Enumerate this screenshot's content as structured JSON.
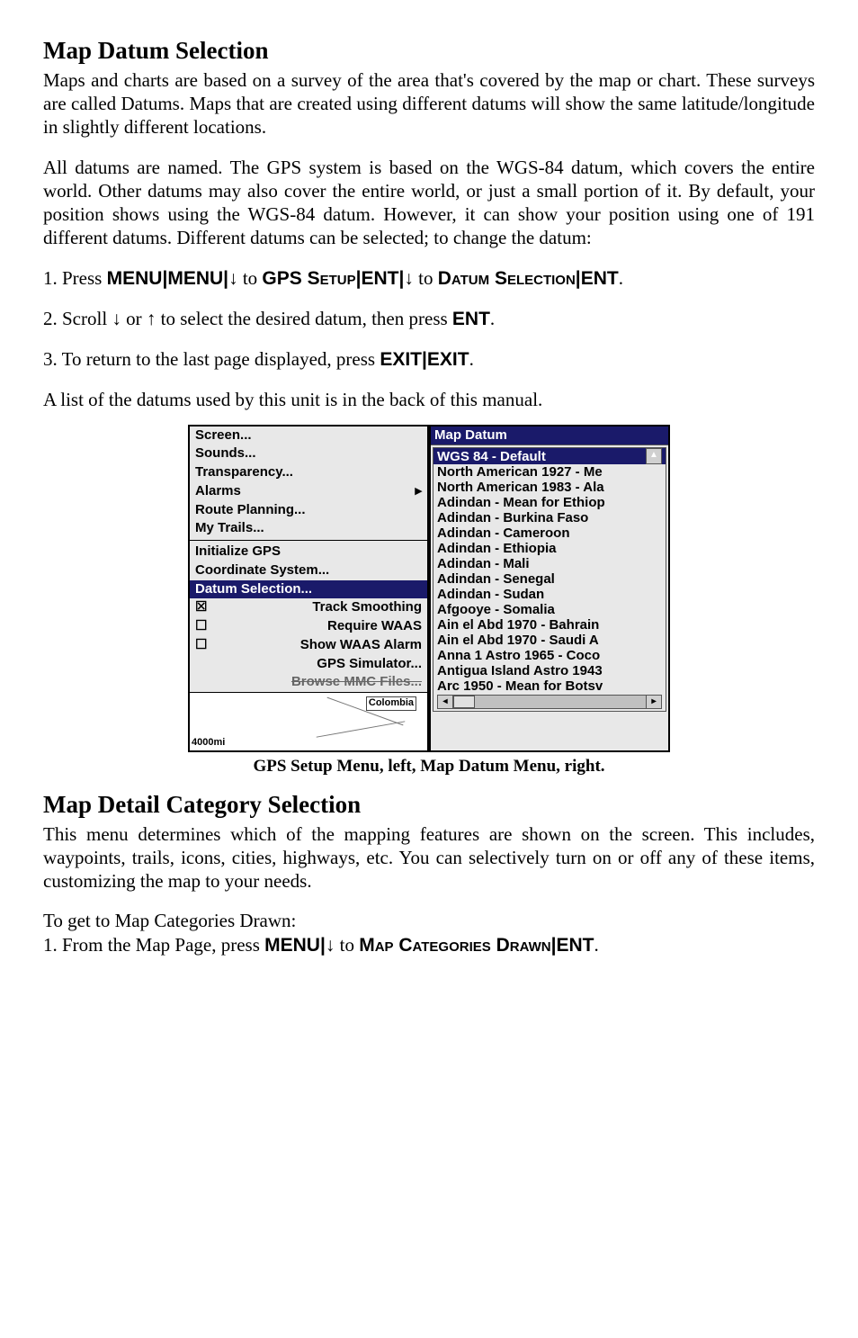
{
  "section1": {
    "heading": "Map Datum Selection",
    "para1": "Maps and charts are based on a survey of the area that's covered by the map or chart. These surveys are called Datums. Maps that are created using different datums will show the same latitude/longitude in slightly different locations.",
    "para2": "All datums are named. The GPS system is based on the WGS-84 datum, which covers the entire world. Other datums may also cover the entire world, or just a small portion of it. By default, your position shows using the WGS-84 datum. However, it can show your position using one of 191 different datums. Different datums can be selected; to change the datum:",
    "step1a": "1. Press ",
    "step1_menu": "MENU",
    "step1_bar": "|",
    "step1_to": " to ",
    "step1_gps": "GPS Setup",
    "step1_ent": "ENT",
    "step1_ds": "Datum Selection",
    "step2a": "2. Scroll ",
    "step2b": " or ",
    "step2c": " to select the desired datum, then press ",
    "step2d": ".",
    "step3a": "3. To return to the last page displayed, press ",
    "step3_exit": "EXIT",
    "para3": "A list of the datums used by this unit is in the back of this manual."
  },
  "left_menu": {
    "items_top": [
      {
        "label": "Screen...",
        "arrow": ""
      },
      {
        "label": "Sounds...",
        "arrow": ""
      },
      {
        "label": "Transparency...",
        "arrow": ""
      },
      {
        "label": "Alarms",
        "arrow": "▸"
      },
      {
        "label": "Route Planning...",
        "arrow": ""
      },
      {
        "label": "My Trails...",
        "arrow": ""
      }
    ],
    "items_mid": [
      {
        "label": "Initialize GPS",
        "arrow": ""
      },
      {
        "label": "Coordinate System...",
        "arrow": ""
      }
    ],
    "selected": "Datum Selection...",
    "items_bot": [
      {
        "cb": "☒",
        "label": "Track Smoothing"
      },
      {
        "cb": "☐",
        "label": "Require WAAS"
      },
      {
        "cb": "☐",
        "label": "Show WAAS Alarm"
      },
      {
        "cb": "",
        "label": "GPS Simulator..."
      },
      {
        "cb": "",
        "label": "Browse MMC Files..."
      }
    ],
    "map_label": "Colombia",
    "map_scale": "4000mi"
  },
  "right_list": {
    "title": "Map Datum",
    "selected": "WGS 84 - Default",
    "items": [
      "North American 1927 - Me",
      "North American 1983 - Ala",
      "Adindan - Mean for Ethiop",
      "Adindan - Burkina Faso",
      "Adindan - Cameroon",
      "Adindan - Ethiopia",
      "Adindan - Mali",
      "Adindan - Senegal",
      "Adindan - Sudan",
      "Afgooye - Somalia",
      "Ain el Abd 1970 - Bahrain",
      "Ain el Abd 1970 - Saudi A",
      "Anna 1 Astro 1965 - Coco",
      "Antigua Island Astro 1943",
      "Arc 1950 - Mean for Botsv"
    ]
  },
  "caption": "GPS Setup Menu, left, Map Datum Menu, right.",
  "section2": {
    "heading": "Map Detail Category Selection",
    "para1": "This menu determines which of the mapping features are shown on the screen. This includes, waypoints, trails, icons, cities, highways, etc. You can selectively turn on or off any of these items, customizing the map to your needs.",
    "lead": "To get to Map Categories Drawn:",
    "step1a": "1. From the Map Page, press ",
    "step1_menu": "MENU",
    "step1_to": " to ",
    "step1_mcd": "Map Categories Drawn",
    "step1_ent": "ENT"
  }
}
